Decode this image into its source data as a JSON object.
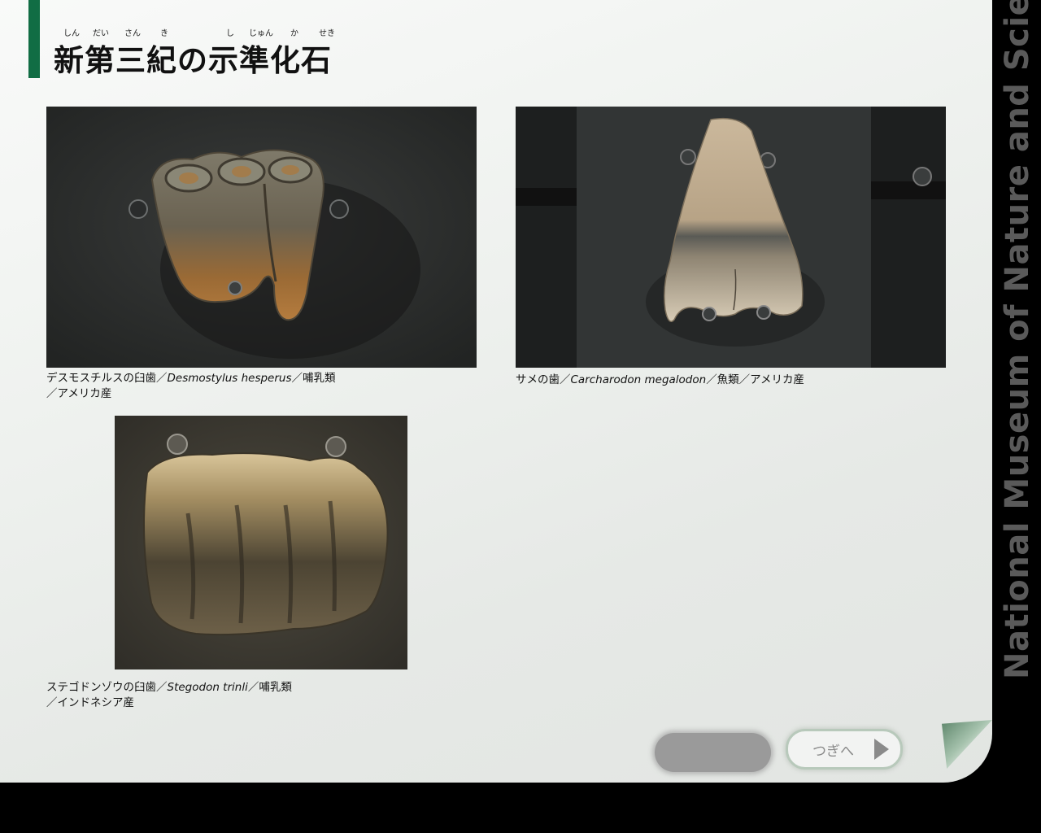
{
  "page": {
    "title": "新第三紀の示準化石",
    "ruby": {
      "shin": "しん",
      "dai": "だい",
      "san": "さん",
      "ki": "き",
      "shi": "し",
      "jun": "じゅん",
      "ka": "か",
      "seki": "せき"
    }
  },
  "specimens": [
    {
      "caption_jp": "デスモスチルスの臼歯／",
      "scientific_name": "Desmostylus hesperus",
      "caption_tail_1": "／哺乳類",
      "caption_tail_2": "／アメリカ産"
    },
    {
      "caption_jp": "サメの歯／",
      "scientific_name": "Carcharodon megalodon",
      "caption_tail_1": "／魚類／アメリカ産"
    },
    {
      "caption_jp": "ステゴドンゾウの臼歯／",
      "scientific_name": "Stegodon trinli",
      "caption_tail_1": "／哺乳類",
      "caption_tail_2": "／インドネシア産"
    }
  ],
  "side_label": "National Museum of Nature and Science",
  "navigation": {
    "next_label": "つぎへ",
    "prev_label": ""
  },
  "colors": {
    "accent_green": "#116d44",
    "background": "#f2f4f2",
    "frame": "#000000"
  }
}
